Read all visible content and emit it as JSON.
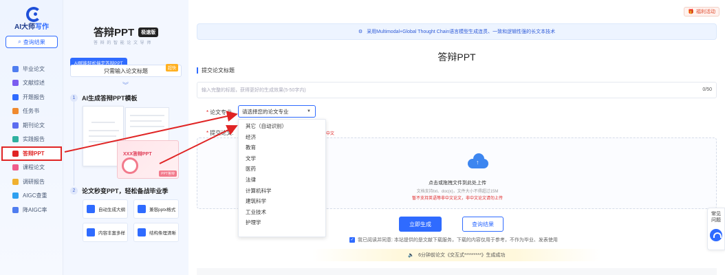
{
  "nav": {
    "logo_text_a": "AI大师",
    "logo_text_b": "写作",
    "query_button": "查询结果",
    "items": [
      {
        "label": "毕业论文",
        "color": "#4f7df0"
      },
      {
        "label": "文献综述",
        "color": "#7b5cf0"
      },
      {
        "label": "开题报告",
        "color": "#2f6bff"
      },
      {
        "label": "任务书",
        "color": "#f08a2f"
      },
      {
        "label": "期刊论文",
        "color": "#5c6cf0"
      },
      {
        "label": "实践报告",
        "color": "#2fb0a0"
      },
      {
        "label": "答辩PPT",
        "color": "#e02424",
        "active": true
      },
      {
        "label": "课程论文",
        "color": "#f05c8a"
      },
      {
        "label": "调研报告",
        "color": "#f0b02f"
      },
      {
        "label": "AIGC查重",
        "color": "#2fa0f0"
      },
      {
        "label": "降AIGC率",
        "color": "#4f7df0"
      }
    ]
  },
  "promo": {
    "title": "答辩PPT",
    "badge": "极速版",
    "subtitle": "答 辩 的 智 能 论 文 导 师",
    "ai_tag": "AI赋能轻松搞定答辩PPT",
    "ai_input": "只需输入论文标题",
    "hot": "超快",
    "step1_num": "1",
    "step1_title": "AI生成答辩PPT模板",
    "slide_title": "XXX答辩PPT",
    "slide_tag": "PPT答辩",
    "step2_num": "2",
    "step2_title": "论文秒变PPT，轻松备战毕业季",
    "features": [
      "自动生成大纲",
      "兼容pptx格式",
      "内容丰富多样",
      "结构条理清晰"
    ]
  },
  "main": {
    "welfare": "福利活动",
    "banner": "采用Multimodal+Global Thought Chain语言模型生成连贯、一致和逻辑性强的长文本技术",
    "page_title": "答辩PPT",
    "section_title": "提交论文标题",
    "title_placeholder": "输入完整的标题，获得更好的生成效果(5-50字内)",
    "title_count": "0/50",
    "major_label": "论文专业",
    "major_placeholder": "请选择您的论文专业",
    "major_options": [
      "其它（自动识别）",
      "经济",
      "教育",
      "文学",
      "医药",
      "法律",
      "计算机科学",
      "建筑科学",
      "工业技术",
      "护理学"
    ],
    "submit_label": "提交论文:",
    "hint_red": "中文",
    "upload_t1": "点击或拖拽文件到此处上传",
    "upload_t2": "文档支持txt、doc(x)，文件大小不得超过15M",
    "upload_t3": "暂不支持英语等非中文论文，非中文论文请勿上传",
    "btn_generate": "立即生成",
    "btn_query": "查询结果",
    "agree_text": "我已阅读并同意: 本站提供的是文献下载服务，下载的内容仅用于参考，不作为毕业、发表使用",
    "notice": "6分钟前论文《交互式*********》生成成功",
    "float_text_a": "常见",
    "float_text_b": "问题"
  }
}
